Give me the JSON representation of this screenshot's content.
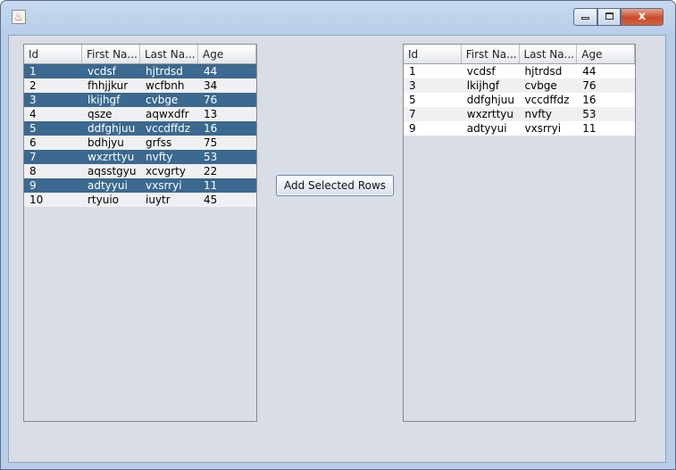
{
  "window": {
    "title": "",
    "app_icon": "java-icon",
    "close_glyph": "x"
  },
  "left_table": {
    "columns": [
      "Id",
      "First Na...",
      "Last Na...",
      "Age"
    ],
    "rows": [
      {
        "cells": [
          "1",
          "vcdsf",
          "hjtrdsd",
          "44"
        ],
        "selected": true
      },
      {
        "cells": [
          "2",
          "fhhjjkur",
          "wcfbnh",
          "34"
        ],
        "selected": false
      },
      {
        "cells": [
          "3",
          "lkijhgf",
          "cvbge",
          "76"
        ],
        "selected": true
      },
      {
        "cells": [
          "4",
          "qsze",
          "aqwxdfr",
          "13"
        ],
        "selected": false
      },
      {
        "cells": [
          "5",
          "ddfghjuu",
          "vccdffdz",
          "16"
        ],
        "selected": true
      },
      {
        "cells": [
          "6",
          "bdhjyu",
          "grfss",
          "75"
        ],
        "selected": false
      },
      {
        "cells": [
          "7",
          "wxzrttyu",
          "nvfty",
          "53"
        ],
        "selected": true
      },
      {
        "cells": [
          "8",
          "aqsstgyu",
          "xcvgrty",
          "22"
        ],
        "selected": false
      },
      {
        "cells": [
          "9",
          "adtyyui",
          "vxsrryi",
          "11"
        ],
        "selected": true
      },
      {
        "cells": [
          "10",
          "rtyuio",
          "iuytr",
          "45"
        ],
        "selected": false
      }
    ]
  },
  "add_button": {
    "label": "Add Selected Rows"
  },
  "right_table": {
    "columns": [
      "Id",
      "First Na...",
      "Last Na...",
      "Age"
    ],
    "rows": [
      {
        "cells": [
          "1",
          "vcdsf",
          "hjtrdsd",
          "44"
        ],
        "selected": false
      },
      {
        "cells": [
          "3",
          "lkijhgf",
          "cvbge",
          "76"
        ],
        "selected": false
      },
      {
        "cells": [
          "5",
          "ddfghjuu",
          "vccdffdz",
          "16"
        ],
        "selected": false
      },
      {
        "cells": [
          "7",
          "wxzrttyu",
          "nvfty",
          "53"
        ],
        "selected": false
      },
      {
        "cells": [
          "9",
          "adtyyui",
          "vxsrryi",
          "11"
        ],
        "selected": false
      }
    ]
  },
  "colors": {
    "selection": "#3b698f",
    "panel": "#d8dde6",
    "alt_row": "#f0f0f2"
  }
}
